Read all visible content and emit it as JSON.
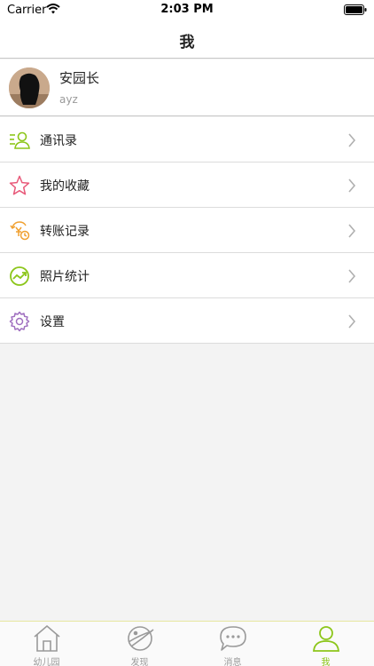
{
  "status_bar": {
    "carrier": "Carrier",
    "time": "2:03 PM"
  },
  "nav": {
    "title": "我"
  },
  "profile": {
    "name": "安园长",
    "account": "ayz"
  },
  "menu": {
    "items": [
      {
        "label": "通讯录",
        "icon": "contacts-icon",
        "color": "#8cc61a"
      },
      {
        "label": "我的收藏",
        "icon": "star-icon",
        "color": "#e85a7a"
      },
      {
        "label": "转账记录",
        "icon": "transfer-icon",
        "color": "#f0a030"
      },
      {
        "label": "照片统计",
        "icon": "photo-stats-icon",
        "color": "#8cc61a"
      },
      {
        "label": "设置",
        "icon": "gear-icon",
        "color": "#a070c0"
      }
    ]
  },
  "tabs": [
    {
      "label": "幼儿园",
      "icon": "home-icon",
      "active": false
    },
    {
      "label": "发现",
      "icon": "planet-icon",
      "active": false
    },
    {
      "label": "消息",
      "icon": "chat-icon",
      "active": false
    },
    {
      "label": "我",
      "icon": "person-icon",
      "active": true
    }
  ],
  "colors": {
    "accent": "#8cc61a",
    "inactive": "#9a9a9a"
  }
}
